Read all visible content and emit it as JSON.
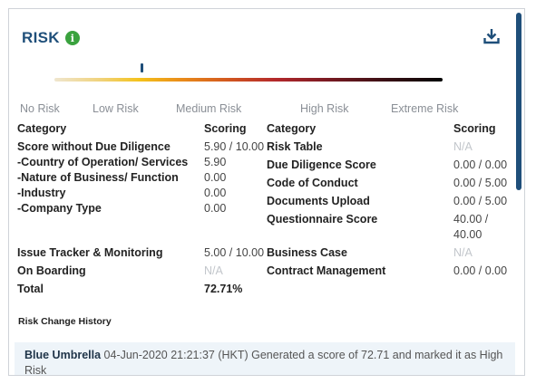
{
  "panel": {
    "title": "RISK",
    "info_icon_glyph": "i",
    "colors": {
      "title": "#1f4f7a",
      "info": "#3aa23e",
      "scroll_thumb": "#1f4f7a",
      "history_bg": "#eef4f9"
    }
  },
  "risk_scale": {
    "marker_fraction": 0.225,
    "labels": [
      "No Risk",
      "Low Risk",
      "Medium Risk",
      "High Risk",
      "Extreme Risk"
    ]
  },
  "table": {
    "left_headers": {
      "category": "Category",
      "scoring": "Scoring"
    },
    "right_headers": {
      "category": "Category",
      "scoring": "Scoring"
    },
    "left_rows": [
      {
        "label": "Score without Due Diligence",
        "value": "5.90 / 10.00"
      },
      {
        "label": "-Country of Operation/ Services",
        "value": "5.90"
      },
      {
        "label": "-Nature of Business/ Function",
        "value": "0.00"
      },
      {
        "label": "-Industry",
        "value": "0.00"
      },
      {
        "label": "-Company Type",
        "value": "0.00"
      },
      {
        "label": "Issue Tracker & Monitoring",
        "value": "5.00 / 10.00"
      },
      {
        "label": "On Boarding",
        "value": "N/A"
      },
      {
        "label": "Total",
        "value": "72.71%"
      }
    ],
    "right_rows": [
      {
        "label": "Risk Table",
        "value": "N/A"
      },
      {
        "label": "Due Diligence Score",
        "value": "0.00 / 0.00"
      },
      {
        "label": "Code of Conduct",
        "value": "0.00 / 5.00"
      },
      {
        "label": "Documents Upload",
        "value": "0.00 / 5.00"
      },
      {
        "label": "Questionnaire Score",
        "value": "40.00 /",
        "value_line2": "40.00"
      },
      {
        "label": "Business Case",
        "value": "N/A"
      },
      {
        "label": "Contract Management",
        "value": "0.00 / 0.00"
      }
    ]
  },
  "history": {
    "title": "Risk Change History",
    "entries": [
      {
        "user": "Blue Umbrella",
        "text": " 04-Jun-2020 21:21:37 (HKT) Generated a score of 72.71 and marked it as High Risk"
      }
    ]
  }
}
